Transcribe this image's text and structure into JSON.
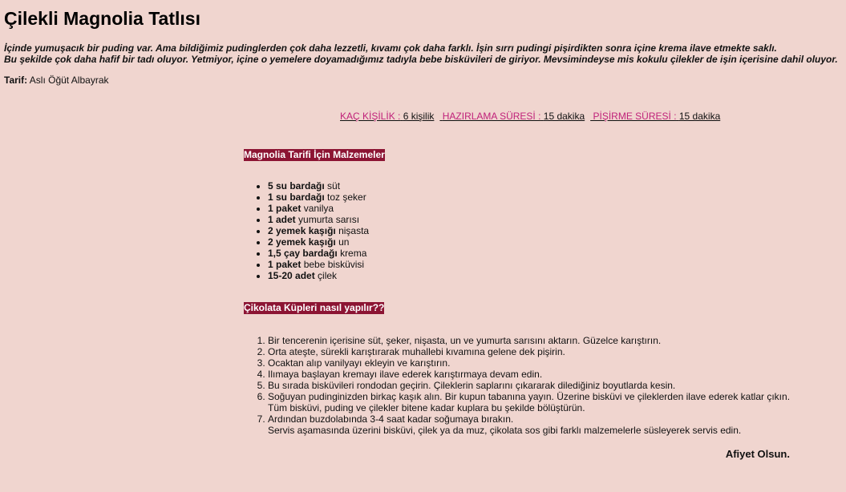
{
  "recipe": {
    "title": "Çilekli Magnolia Tatlısı",
    "intro": [
      "İçinde yumuşacık bir puding var. Ama bildiğimiz pudinglerden çok daha lezzetli, kıvamı çok daha farklı. İşin sırrı pudingi pişirdikten sonra içine krema ilave etmekte saklı.",
      "Bu şekilde çok daha hafif bir tadı oluyor. Yetmiyor, içine o yemelere doyamadığımız tadıyla bebe bisküvileri de giriyor. Mevsimindeyse mis kokulu çilekler de işin içerisine dahil oluyor."
    ],
    "author_label": "Tarif:",
    "author_name": "Aslı Öğüt Albayrak"
  },
  "meta": [
    {
      "label": "KAÇ KİŞİLİK :",
      "value": "6 kişilik"
    },
    {
      "label": "HAZIRLAMA SÜRESİ :",
      "value": "15 dakika"
    },
    {
      "label": "PİŞİRME SÜRESİ :",
      "value": "15 dakika"
    }
  ],
  "ingredients": {
    "header": "Magnolia Tarifi İçin Malzemeler",
    "items": [
      {
        "qty": "5 su bardağı",
        "name": "süt"
      },
      {
        "qty": "1 su bardağı",
        "name": "toz şeker"
      },
      {
        "qty": "1 paket",
        "name": "vanilya"
      },
      {
        "qty": "1 adet",
        "name": "yumurta sarısı"
      },
      {
        "qty": "2 yemek kaşığı",
        "name": "nişasta"
      },
      {
        "qty": "2 yemek kaşığı",
        "name": "un"
      },
      {
        "qty": "1,5 çay bardağı",
        "name": "krema"
      },
      {
        "qty": "1 paket",
        "name": "bebe bisküvisi"
      },
      {
        "qty": "15-20 adet",
        "name": "çilek"
      }
    ]
  },
  "steps": {
    "header": "Çikolata Küpleri nasıl yapılır??",
    "items": [
      [
        "Bir tencerenin içerisine süt, şeker, nişasta, un ve yumurta sarısını aktarın. Güzelce karıştırın."
      ],
      [
        "Orta ateşte, sürekli karıştırarak muhallebi kıvamına gelene dek pişirin."
      ],
      [
        "Ocaktan alıp vanilyayı ekleyin ve karıştırın."
      ],
      [
        "Ilımaya başlayan kremayı ilave ederek karıştırmaya devam edin."
      ],
      [
        "Bu sırada bisküvileri rondodan geçirin. Çileklerin saplarını çıkararak dilediğiniz boyutlarda kesin."
      ],
      [
        "Soğuyan pudinginizden birkaç kaşık alın. Bir kupun tabanına yayın. Üzerine bisküvi ve çileklerden ilave ederek katlar çıkın.",
        "Tüm bisküvi, puding ve çilekler bitene kadar kuplara bu şekilde bölüştürün."
      ],
      [
        "Ardından buzdolabında 3-4 saat kadar soğumaya bırakın.",
        "Servis aşamasında üzerini bisküvi, çilek ya da muz, çikolata sos gibi farklı malzemelerle süsleyerek servis edin."
      ]
    ]
  },
  "closing": "Afiyet Olsun.",
  "colors": {
    "background": "#f0d5cf",
    "header_bg": "#8c1433",
    "link": "#c0217a"
  }
}
